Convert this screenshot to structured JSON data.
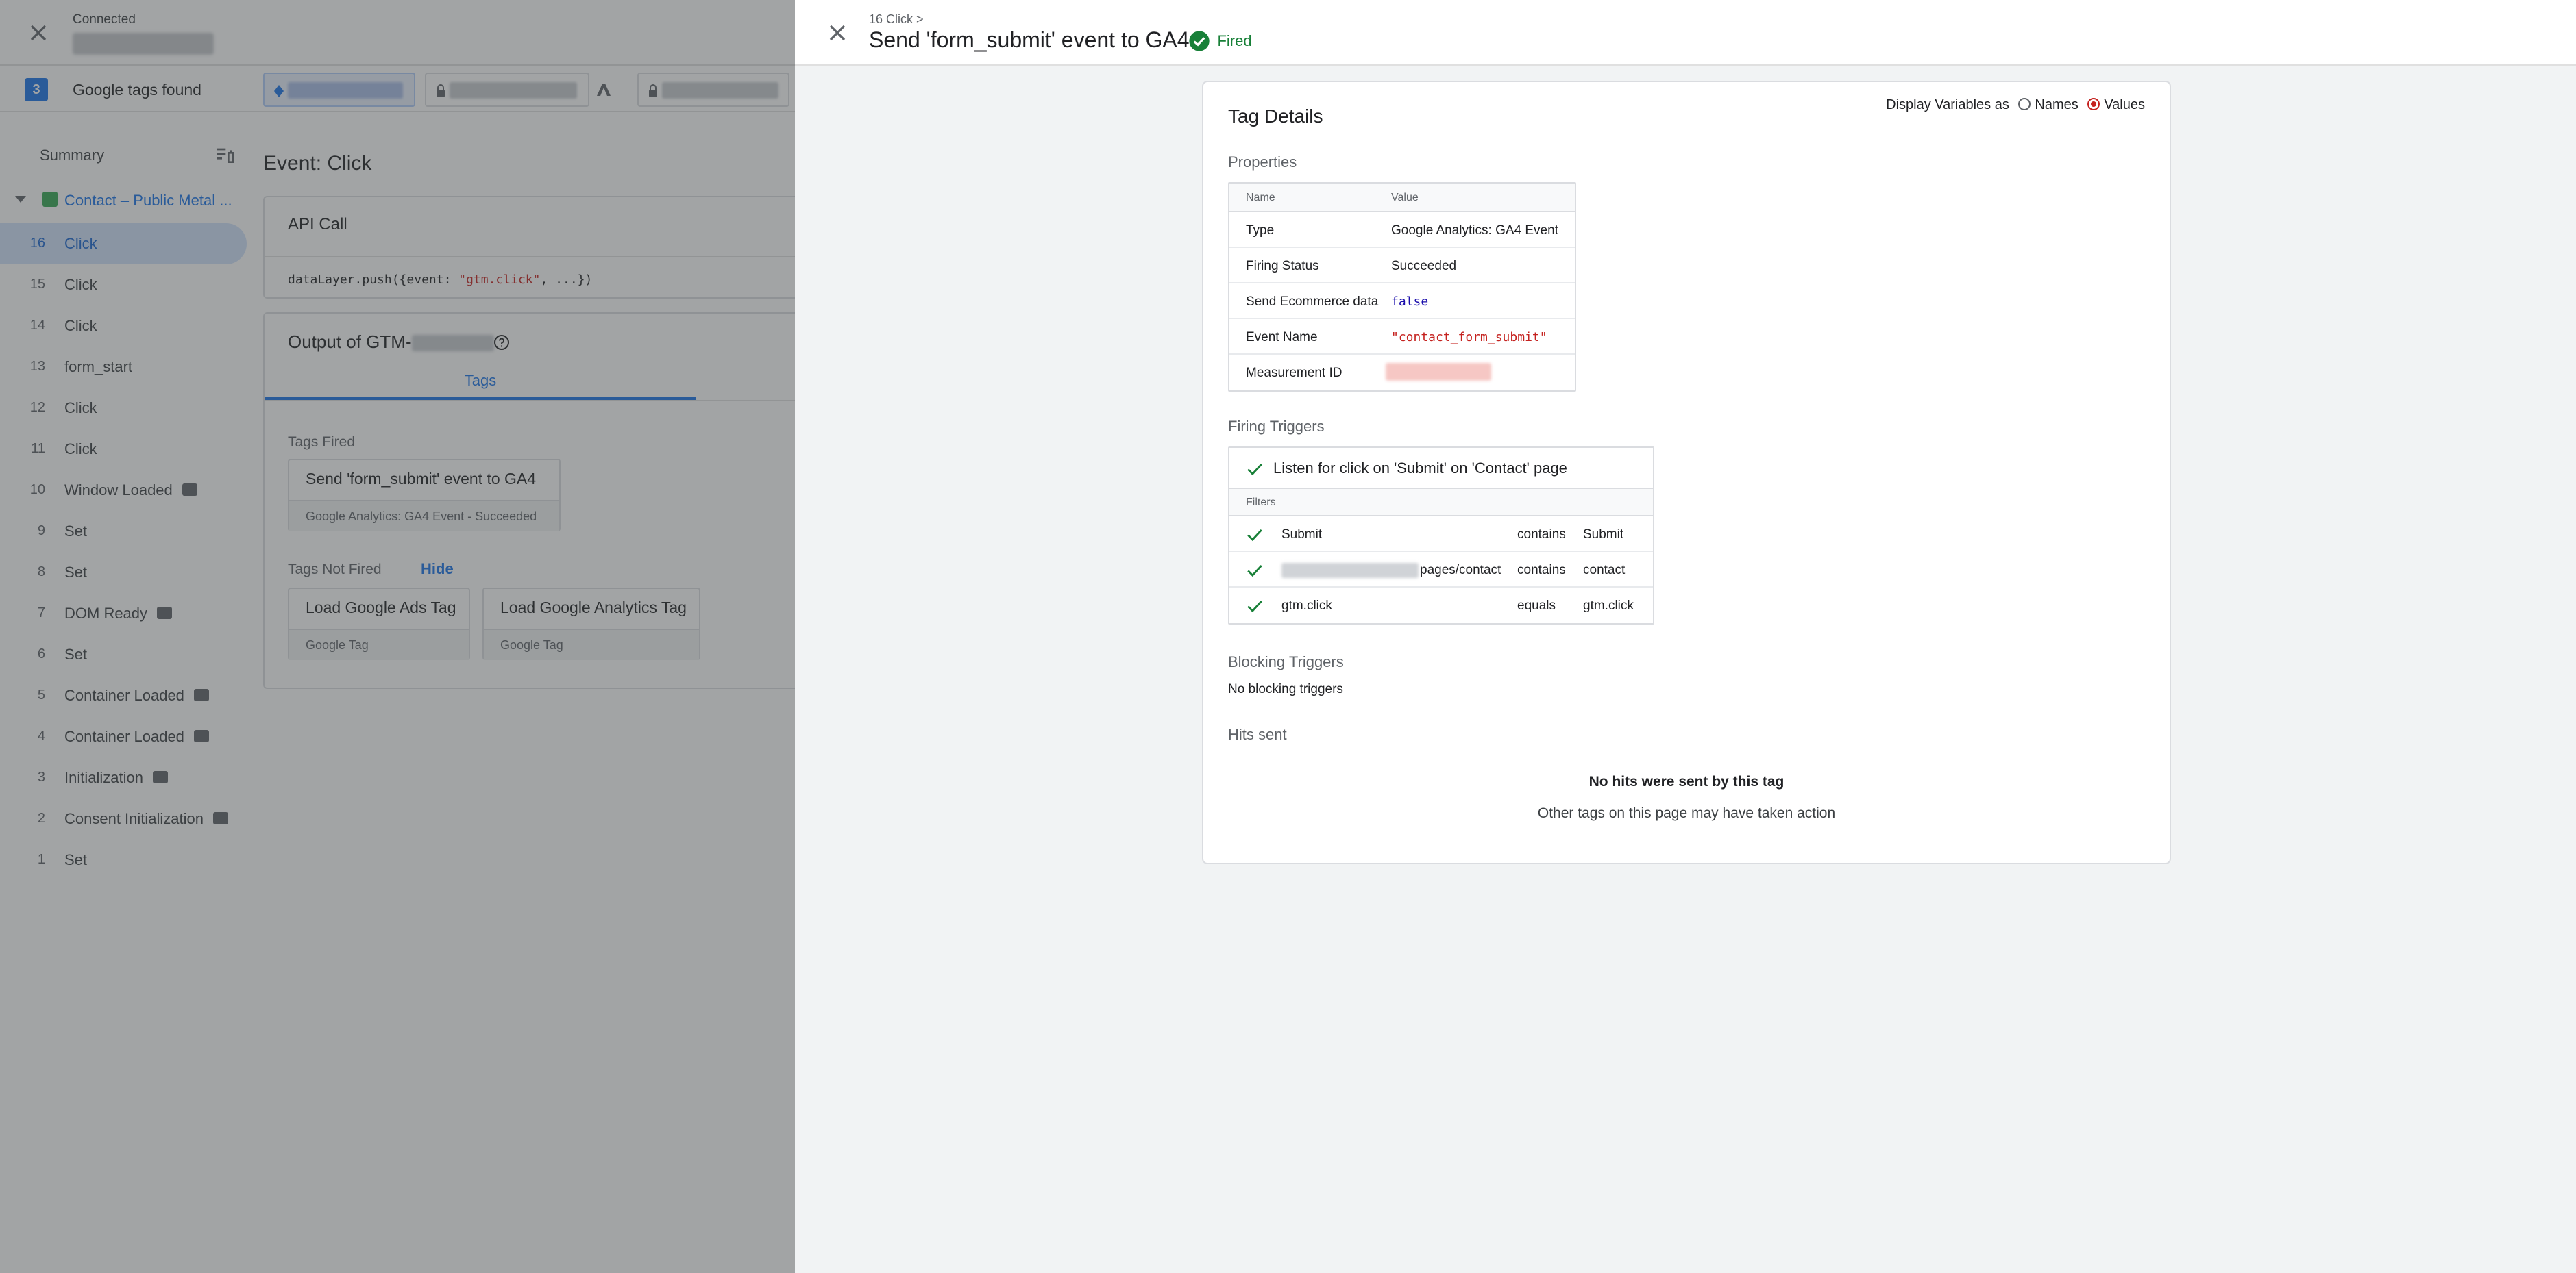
{
  "background": {
    "connection_status": "Connected",
    "tags_found_count": "3",
    "tags_found_label": "Google tags found",
    "summary_label": "Summary",
    "page_name": "Contact – Public Metal ...",
    "events": [
      {
        "num": "16",
        "name": "Click",
        "active": true,
        "badge": false
      },
      {
        "num": "15",
        "name": "Click",
        "badge": false
      },
      {
        "num": "14",
        "name": "Click",
        "badge": false
      },
      {
        "num": "13",
        "name": "form_start",
        "badge": false
      },
      {
        "num": "12",
        "name": "Click",
        "badge": false
      },
      {
        "num": "11",
        "name": "Click",
        "badge": false
      },
      {
        "num": "10",
        "name": "Window Loaded",
        "badge": true
      },
      {
        "num": "9",
        "name": "Set",
        "badge": false
      },
      {
        "num": "8",
        "name": "Set",
        "badge": false
      },
      {
        "num": "7",
        "name": "DOM Ready",
        "badge": true
      },
      {
        "num": "6",
        "name": "Set",
        "badge": false
      },
      {
        "num": "5",
        "name": "Container Loaded",
        "badge": true
      },
      {
        "num": "4",
        "name": "Container Loaded",
        "badge": true
      },
      {
        "num": "3",
        "name": "Initialization",
        "badge": true
      },
      {
        "num": "2",
        "name": "Consent Initialization",
        "badge": true
      },
      {
        "num": "1",
        "name": "Set",
        "badge": false
      }
    ],
    "event_title": "Event: Click",
    "api_call_label": "API Call",
    "api_code_prefix": "dataLayer.push({event: ",
    "api_code_string": "\"gtm.click\"",
    "api_code_suffix": ", ...})",
    "output_label": "Output of GTM-",
    "tab_tags": "Tags",
    "tags_fired_label": "Tags Fired",
    "tags_fired": [
      {
        "name": "Send 'form_submit' event to GA4",
        "sub": "Google Analytics: GA4 Event - Succeeded"
      }
    ],
    "tags_not_fired_label": "Tags Not Fired",
    "hide_label": "Hide",
    "tags_not_fired": [
      {
        "name": "Load Google Ads Tag",
        "sub": "Google Tag"
      },
      {
        "name": "Load Google Analytics Tag",
        "sub": "Google Tag"
      }
    ]
  },
  "panel": {
    "breadcrumb": "16 Click >",
    "title": "Send 'form_submit' event to GA4",
    "status": "Fired",
    "status_color": "#188038",
    "details_title": "Tag Details",
    "display_vars_label": "Display Variables as",
    "display_opt_names": "Names",
    "display_opt_values": "Values",
    "display_selected": "Values",
    "properties_label": "Properties",
    "props_header_name": "Name",
    "props_header_value": "Value",
    "properties": [
      {
        "name": "Type",
        "value": "Google Analytics: GA4 Event",
        "kind": "text"
      },
      {
        "name": "Firing Status",
        "value": "Succeeded",
        "kind": "text"
      },
      {
        "name": "Send Ecommerce data",
        "value": "false",
        "kind": "bool"
      },
      {
        "name": "Event Name",
        "value": "\"contact_form_submit\"",
        "kind": "str"
      },
      {
        "name": "Measurement ID",
        "value": "",
        "kind": "redacted"
      }
    ],
    "firing_triggers_label": "Firing Triggers",
    "trigger_name": "Listen for click on 'Submit' on 'Contact' page",
    "filters_label": "Filters",
    "filters": [
      {
        "a": "Submit",
        "op": "contains",
        "b": "Submit",
        "redacted_prefix": false
      },
      {
        "a": "pages/contact",
        "op": "contains",
        "b": "contact",
        "redacted_prefix": true
      },
      {
        "a": "gtm.click",
        "op": "equals",
        "b": "gtm.click",
        "redacted_prefix": false
      }
    ],
    "blocking_triggers_label": "Blocking Triggers",
    "no_blocking": "No blocking triggers",
    "hits_sent_label": "Hits sent",
    "no_hits_title": "No hits were sent by this tag",
    "no_hits_sub": "Other tags on this page may have taken action"
  }
}
